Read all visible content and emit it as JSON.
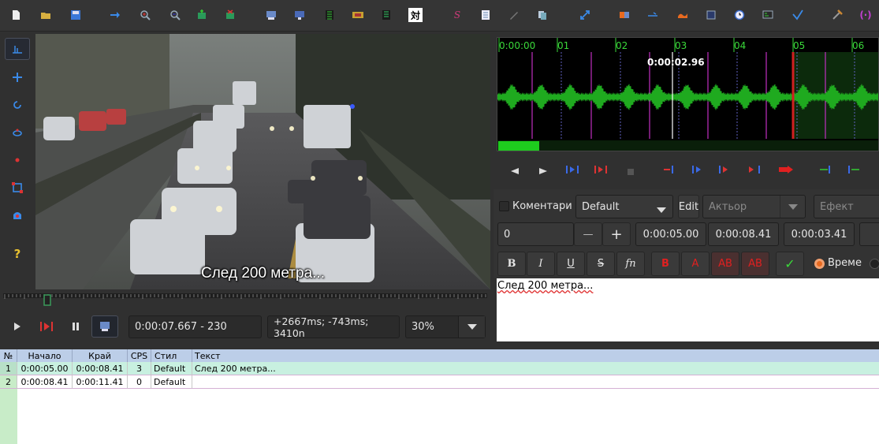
{
  "toolbar": {
    "icons": [
      "new-file-icon",
      "open-file-icon",
      "save-icon",
      "jump-icon",
      "zoom-in-icon",
      "zoom-out-icon",
      "add-line-icon",
      "delete-line-icon",
      "video-icon",
      "audio-icon",
      "keyframe-icon",
      "film-icon",
      "grid-icon",
      "kanji",
      "script",
      "notes",
      "pen",
      "copy",
      "sync",
      "shift",
      "timing",
      "snap",
      "colors",
      "clock",
      "spell",
      "check",
      "tools",
      "braces"
    ],
    "kanji_label": "対",
    "script_label": "S"
  },
  "video": {
    "subtitle_text": "След 200 метра..."
  },
  "controls": {
    "time_frame": "0:00:07.667 - 230",
    "offset_info": "+2667ms; -743ms; 3410n",
    "zoom": "30%"
  },
  "audio": {
    "ruler_labels": [
      "0:00:00",
      "01",
      "02",
      "03",
      "04",
      "05",
      "06"
    ],
    "cursor_time": "0:00:02.96"
  },
  "edit": {
    "comment_label": "Коментари",
    "style_value": "Default",
    "edit_button": "Edit",
    "actor_placeholder": "Актьор",
    "effect_placeholder": "Ефект",
    "layer_value": "0",
    "minus_label": "—",
    "plus_label": "+",
    "start_time": "0:00:05.00",
    "end_time": "0:00:08.41",
    "duration": "0:00:03.41",
    "fmt_bold": "B",
    "fmt_italic": "I",
    "fmt_underline": "U",
    "fmt_strike": "S",
    "fmt_font": "fn",
    "color_1": "B",
    "color_2": "A",
    "color_3": "AB",
    "color_4": "AB",
    "commit_label": "✓",
    "time_radio_label": "Време",
    "text": "След 200 метра..."
  },
  "grid": {
    "headers": [
      "№",
      "Начало",
      "Край",
      "CPS",
      "Стил",
      "Текст"
    ],
    "rows": [
      {
        "num": "1",
        "start": "0:00:05.00",
        "end": "0:00:08.41",
        "cps": "3",
        "style": "Default",
        "text": "След 200 метра..."
      },
      {
        "num": "2",
        "start": "0:00:08.41",
        "end": "0:00:11.41",
        "cps": "0",
        "style": "Default",
        "text": ""
      }
    ]
  },
  "colors": {
    "waveform": "#1faa1f",
    "selection_row": "#c8f0e0",
    "grid_header": "#bccee8",
    "marker": "#cc33cc"
  }
}
